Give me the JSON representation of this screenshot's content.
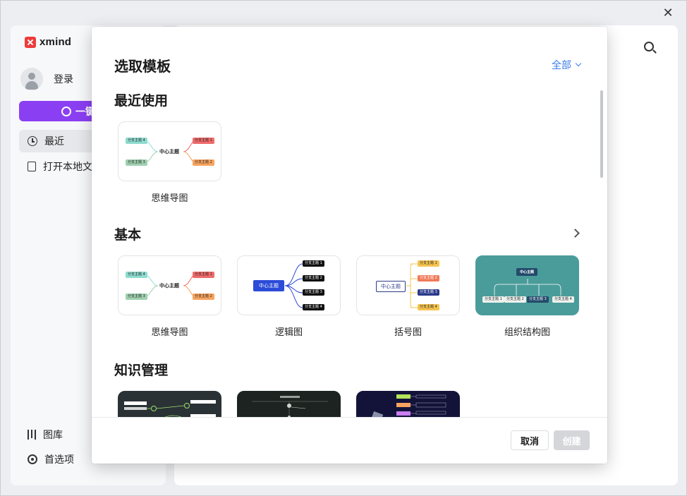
{
  "window": {
    "close_symbol": "✕"
  },
  "sidebar": {
    "brand": "xmind",
    "login": "登录",
    "onekey": "一键",
    "items": [
      {
        "label": "最近",
        "icon": "clock-icon"
      },
      {
        "label": "打开本地文",
        "icon": "open-file-icon"
      },
      {
        "label": "图库",
        "icon": "library-icon"
      },
      {
        "label": "首选项",
        "icon": "gear-icon"
      }
    ]
  },
  "dialog": {
    "title": "选取模板",
    "filter_label": "全部",
    "sections": [
      {
        "title": "最近使用",
        "cards": [
          {
            "label": "思维导图",
            "center": "中心主题",
            "nodes": [
              "分支主题 4",
              "分支主题 3",
              "分支主题 1",
              "分支主题 2"
            ]
          }
        ]
      },
      {
        "title": "基本",
        "cards": [
          {
            "label": "思维导图",
            "center": "中心主题",
            "nodes": [
              "分支主题 4",
              "分支主题 3",
              "分支主题 1",
              "分支主题 2"
            ]
          },
          {
            "label": "逻辑图",
            "center": "中心主题",
            "nodes": [
              "分支主题 1",
              "分支主题 2",
              "分支主题 3",
              "分支主题 4"
            ]
          },
          {
            "label": "括号图",
            "center": "中心主题",
            "nodes": [
              "分支主题 1",
              "分支主题 2",
              "分支主题 3",
              "分支主题 4"
            ]
          },
          {
            "label": "组织结构图",
            "center": "中心主题",
            "nodes": [
              "分支主题 1",
              "分支主题 2",
              "分支主题 3",
              "分支主题 4"
            ]
          }
        ]
      },
      {
        "title": "知识管理"
      }
    ],
    "cancel": "取消",
    "create": "创建"
  },
  "colors": {
    "accent_purple": "#8b3ff2",
    "link_blue": "#3a7ee8",
    "node_teal": "#8fdcd0",
    "node_green": "#9fd0b0",
    "node_red": "#f06b6b",
    "node_orange": "#f7a45f",
    "logic_blue": "#2b4bd8",
    "bracket_yellow": "#f5c451",
    "org_bg": "#4a9c9a",
    "org_dark": "#234a6b"
  }
}
